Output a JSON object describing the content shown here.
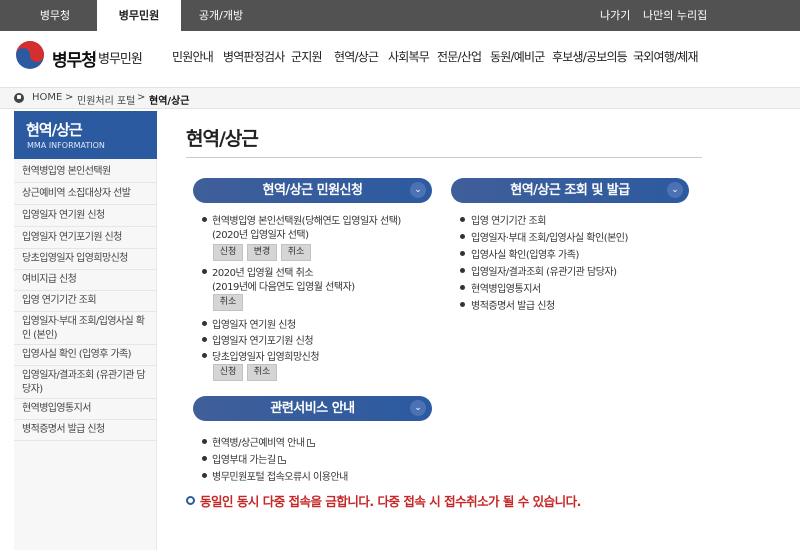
{
  "topbar": {
    "tabs": [
      "병무청",
      "병무민원",
      "공개/개방"
    ],
    "links": [
      "나가기",
      "나만의 누리집"
    ]
  },
  "header": {
    "logo": "병무청",
    "logo_sub": "병무민원",
    "nav": [
      "민원안내",
      "병역판정검사",
      "군지원",
      "현역/상근",
      "사회복무",
      "전문/산업",
      "동원/예비군",
      "후보생/공보의등",
      "국외여행/체재"
    ]
  },
  "breadcrumb": [
    "HOME",
    ">",
    "민원처리 포털",
    ">",
    "현역/상근"
  ],
  "sidebar": {
    "title": "현역/상근",
    "subtitle": "MMA INFORMATION",
    "items": [
      "현역병입영 본인선택원",
      "상근예비역 소집대상자 선발",
      "입영일자 연기원 신청",
      "입영일자 연기포기원 신청",
      "당초입영일자 입영희망신청",
      "여비지급 신청",
      "입영 연기기간 조회",
      "입영일자·부대 조회/입영사실 확인 (본인)",
      "입영사실 확인 (입영후 가족)",
      "입영일자/결과조회 (유관기관 담당자)",
      "현역병입영통지서",
      "병적증명서 발급 신청"
    ]
  },
  "main": {
    "title": "현역/상근",
    "section1": {
      "header": "현역/상근 민원신청",
      "items": [
        "현역병입영 본인선택원(당해연도 입영일자 선택)",
        "(2020년 입영일자 선택)",
        "2020년 입영월 선택 취소",
        "(2019년에 다음연도 입영월 선택자)",
        "입영일자 연기원 신청",
        "입영일자 연기포기원 신청",
        "당초입영일자 입영희망신청"
      ],
      "buttons": {
        "apply": "신청",
        "change": "변경",
        "cancel": "취소"
      }
    },
    "section2": {
      "header": "현역/상근 조회 및 발급",
      "items": [
        "입영 연기기간 조회",
        "입영일자·부대 조회/입영사실 확인(본인)",
        "입영사실 확인(입영후 가족)",
        "입영일자/결과조회 (유관기관 담당자)",
        "현역병입영통지서",
        "병적증명서 발급 신청"
      ]
    },
    "section3": {
      "header": "관련서비스 안내",
      "items": [
        "현역병/상근예비역 안내",
        "입영부대 가는길",
        "병무민원포털 접속오류시 이용안내"
      ]
    },
    "notice": "동일인 동시 다중 접속을 금합니다. 다중 접속 시 접수취소가 될 수 있습니다."
  },
  "colors": {
    "accent": "#2c5aa0",
    "topbar": "#525252",
    "notice": "#c62828"
  }
}
